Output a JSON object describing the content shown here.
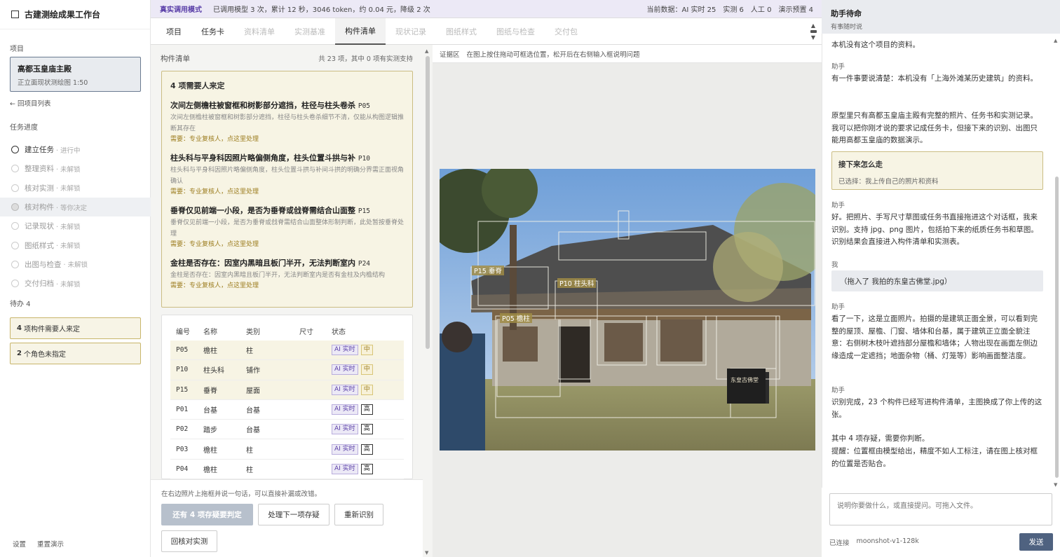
{
  "app": {
    "title": "古建测绘成果工作台"
  },
  "sidebar": {
    "project_label": "项目",
    "project": {
      "name": "高都玉皇庙主殿",
      "sub": "正立面现状测绘图 1:50"
    },
    "back": "← 回项目列表",
    "progress_label": "任务进度",
    "steps": [
      {
        "name": "建立任务",
        "status": "· 进行中"
      },
      {
        "name": "整理资料",
        "status": "· 未解锁"
      },
      {
        "name": "核对实测",
        "status": "· 未解锁"
      },
      {
        "name": "核对构件",
        "status": "· 等你决定"
      },
      {
        "name": "记录现状",
        "status": "· 未解锁"
      },
      {
        "name": "图纸样式",
        "status": "· 未解锁"
      },
      {
        "name": "出图与检查",
        "status": "· 未解锁"
      },
      {
        "name": "交付归档",
        "status": "· 未解锁"
      }
    ],
    "todo_label": "待办 4",
    "todos": [
      {
        "num": "4",
        "text": "项构件需要人来定"
      },
      {
        "num": "2",
        "text": "个角色未指定"
      }
    ],
    "footer": {
      "settings": "设置",
      "reset": "重置演示"
    }
  },
  "topbar": {
    "mode": "真实调用模式",
    "stats": "已调用模型 3 次，累计 12 秒，3046 token，约 0.04 元，降级 2 次",
    "current": "当前数据：AI 实时 25",
    "measured": "实测 6",
    "manual": "人工 0",
    "preset": "演示预置 4"
  },
  "tabs": [
    {
      "label": "项目",
      "state": "normal"
    },
    {
      "label": "任务卡",
      "state": "normal"
    },
    {
      "label": "资料清单",
      "state": "disabled"
    },
    {
      "label": "实测基准",
      "state": "disabled"
    },
    {
      "label": "构件清单",
      "state": "active"
    },
    {
      "label": "现状记录",
      "state": "disabled"
    },
    {
      "label": "图纸样式",
      "state": "disabled"
    },
    {
      "label": "图纸与检查",
      "state": "disabled"
    },
    {
      "label": "交付包",
      "state": "disabled"
    }
  ],
  "components": {
    "title": "构件清单",
    "count": "共 23 项，其中 0 项有实测支持",
    "issues_title": "4 项需要人来定",
    "issues": [
      {
        "title": "次间左侧檐柱被窗框和树影部分遮挡，柱径与柱头卷杀",
        "code": "P05",
        "desc": "次间左侧檐柱被窗框和树影部分遮挡，柱径与柱头卷杀细节不清，仅能从构图逻辑推断其存在",
        "need": "需要：专业复核人，点这里处理"
      },
      {
        "title": "柱头科与平身科因照片略偏侧角度，柱头位置斗拱与补",
        "code": "P10",
        "desc": "柱头科与平身科因照片略偏侧角度，柱头位置斗拱与补间斗拱的明确分界需正面视角确认",
        "need": "需要：专业复核人，点这里处理"
      },
      {
        "title": "垂脊仅见前端一小段，是否为垂脊或戗脊需结合山面整",
        "code": "P15",
        "desc": "垂脊仅见前端一小段，是否为垂脊或戗脊需结合山面整体形制判断，此处暂按垂脊处理",
        "need": "需要：专业复核人，点这里处理"
      },
      {
        "title": "金柱是否存在：因室内黑暗且板门半开，无法判断室内",
        "code": "P24",
        "desc": "金柱是否存在：因室内黑暗且板门半开，无法判断室内是否有金柱及内檐结构",
        "need": "需要：专业复核人，点这里处理"
      }
    ],
    "table_headers": {
      "code": "编号",
      "name": "名称",
      "type": "类别",
      "size": "尺寸",
      "status": "状态"
    },
    "rows": [
      {
        "code": "P05",
        "name": "檐柱",
        "type": "柱",
        "size": "",
        "ai": "AI 实时",
        "conf": "中",
        "level": "m"
      },
      {
        "code": "P10",
        "name": "柱头科",
        "type": "铺作",
        "size": "",
        "ai": "AI 实时",
        "conf": "中",
        "level": "m"
      },
      {
        "code": "P15",
        "name": "垂脊",
        "type": "屋面",
        "size": "",
        "ai": "AI 实时",
        "conf": "中",
        "level": "m"
      },
      {
        "code": "P01",
        "name": "台基",
        "type": "台基",
        "size": "",
        "ai": "AI 实时",
        "conf": "高",
        "level": "h"
      },
      {
        "code": "P02",
        "name": "踏步",
        "type": "台基",
        "size": "",
        "ai": "AI 实时",
        "conf": "高",
        "level": "h"
      },
      {
        "code": "P03",
        "name": "檐柱",
        "type": "柱",
        "size": "",
        "ai": "AI 实时",
        "conf": "高",
        "level": "h"
      },
      {
        "code": "P04",
        "name": "檐柱",
        "type": "柱",
        "size": "",
        "ai": "AI 实时",
        "conf": "高",
        "level": "h"
      }
    ]
  },
  "actions": {
    "hint": "在右边照片上拖框并说一句话，可以直接补漏或改错。",
    "btn_disabled": "还有 4 项存疑要判定",
    "btn_next": "处理下一项存疑",
    "btn_rerun": "重新识别",
    "btn_back": "回核对实测"
  },
  "evidence": {
    "label": "证据区",
    "hint": "在图上按住拖动可框选位置，松开后在右侧输入框说明问题",
    "tags": {
      "p15": "P15 垂脊",
      "p10": "P10 柱头科",
      "p05": "P05 檐柱"
    },
    "plaque": "东皇古佛堂"
  },
  "chat": {
    "head_title": "助手待命",
    "head_sub": "有事随时说",
    "m0": "本机没有这个项目的资料。",
    "who_assistant": "助手",
    "who_me": "我",
    "m1": "有一件事要说清楚：本机没有「上海外滩某历史建筑」的资料。",
    "m1b": "原型里只有高都玉皇庙主殿有完整的照片、任务书和实测记录。我可以把你刚才说的要求记成任务卡，但接下来的识别、出图只能用高都玉皇庙的数据演示。",
    "next_title": "接下来怎么走",
    "next_sub": "已选择：我上传自己的照片和资料",
    "m2": "好。把照片、手写尺寸草图或任务书直接拖进这个对话框，我来识别。支持 jpg、png 图片，包括拍下来的纸质任务书和草图。识别结果会直接进入构件清单和实测表。",
    "mine": "（拖入了 我拍的东皇古佛堂.jpg）",
    "m3": "看了一下，这是立面照片。拍摄的是建筑正面全景，可以看到完整的屋顶、屋檐、门窗、墙体和台基，属于建筑正立面全貌注意：右侧树木枝叶遮挡部分屋檐和墙体；人物出现在画面左侧边缘造成一定遮挡；地面杂物（桶、灯笼等）影响画面整洁度。",
    "m4": "识别完成，23 个构件已经写进构件清单，主图换成了你上传的这张。",
    "m4b": "其中 4 项存疑，需要你判断。",
    "m4c": "提醒：位置框由模型给出，精度不如人工标注，请在图上核对框的位置是否贴合。",
    "input_placeholder": "说明你要做什么，或直接提问。可拖入文件。",
    "conn": "已连接",
    "model": "moonshot-v1-128k",
    "send": "发送"
  },
  "colors": {
    "accent": "#4f6280",
    "warn_bg": "#f7f4e4",
    "warn_border": "#cbbd83",
    "ai_purple": "#5a3fa8"
  }
}
